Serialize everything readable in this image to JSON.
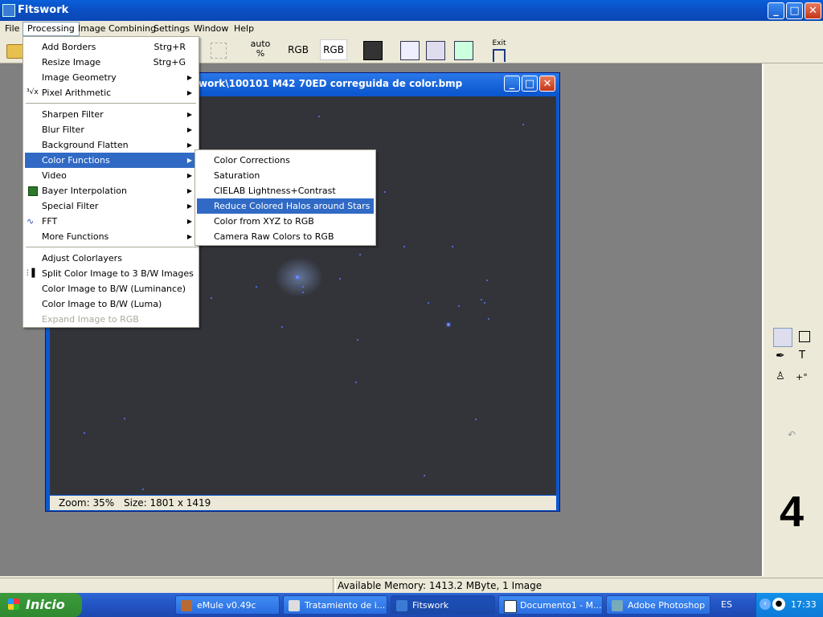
{
  "app": {
    "title": "Fitswork"
  },
  "menubar": [
    "File",
    "Processing",
    "Image Combining",
    "Settings",
    "Window",
    "Help"
  ],
  "toolbar": {
    "auto_top": "auto",
    "auto_bottom": "%",
    "rgb1": "RGB",
    "rgb2": "RGB",
    "exit": "Exit"
  },
  "child": {
    "title": "work\\100101 M42 70ED correguida de color.bmp",
    "zoom": "Zoom: 35%",
    "size": "Size: 1801 x 1419"
  },
  "processing_menu": [
    {
      "label": "Add Borders",
      "shortcut": "Strg+R"
    },
    {
      "label": "Resize Image",
      "shortcut": "Strg+G"
    },
    {
      "label": "Image Geometry",
      "sub": true
    },
    {
      "label": "Pixel Arithmetic",
      "sub": true,
      "icon": "³√x"
    },
    {
      "label": "Sharpen Filter",
      "sub": true
    },
    {
      "label": "Blur Filter",
      "sub": true
    },
    {
      "label": "Background Flatten",
      "sub": true
    },
    {
      "label": "Color Functions",
      "sub": true,
      "selected": true
    },
    {
      "label": "Video",
      "sub": true
    },
    {
      "label": "Bayer Interpolation",
      "sub": true
    },
    {
      "label": "Special Filter",
      "sub": true
    },
    {
      "label": "FFT",
      "sub": true
    },
    {
      "label": "More Functions",
      "sub": true
    },
    {
      "label": "Adjust Colorlayers"
    },
    {
      "label": "Split Color Image to 3 B/W Images"
    },
    {
      "label": "Color Image to B/W (Luminance)"
    },
    {
      "label": "Color Image to B/W (Luma)"
    },
    {
      "label": "Expand Image to RGB",
      "disabled": true
    }
  ],
  "color_functions_menu": [
    {
      "label": "Color Corrections"
    },
    {
      "label": "Saturation"
    },
    {
      "label": "CIELAB Lightness+Contrast"
    },
    {
      "label": "Reduce Colored Halos around Stars",
      "selected": true
    },
    {
      "label": "Color from XYZ to RGB"
    },
    {
      "label": "Camera Raw Colors to RGB"
    }
  ],
  "right_panel": {
    "big_number": "4"
  },
  "statusbar": {
    "memory": "Available Memory: 1413.2 MByte, 1 Image"
  },
  "taskbar": {
    "start": "Inicio",
    "tasks": [
      "eMule v0.49c",
      "Tratamiento de i...",
      "Fitswork",
      "Documento1 - M...",
      "Adobe Photoshop"
    ],
    "lang": "ES",
    "time": "17:33"
  }
}
